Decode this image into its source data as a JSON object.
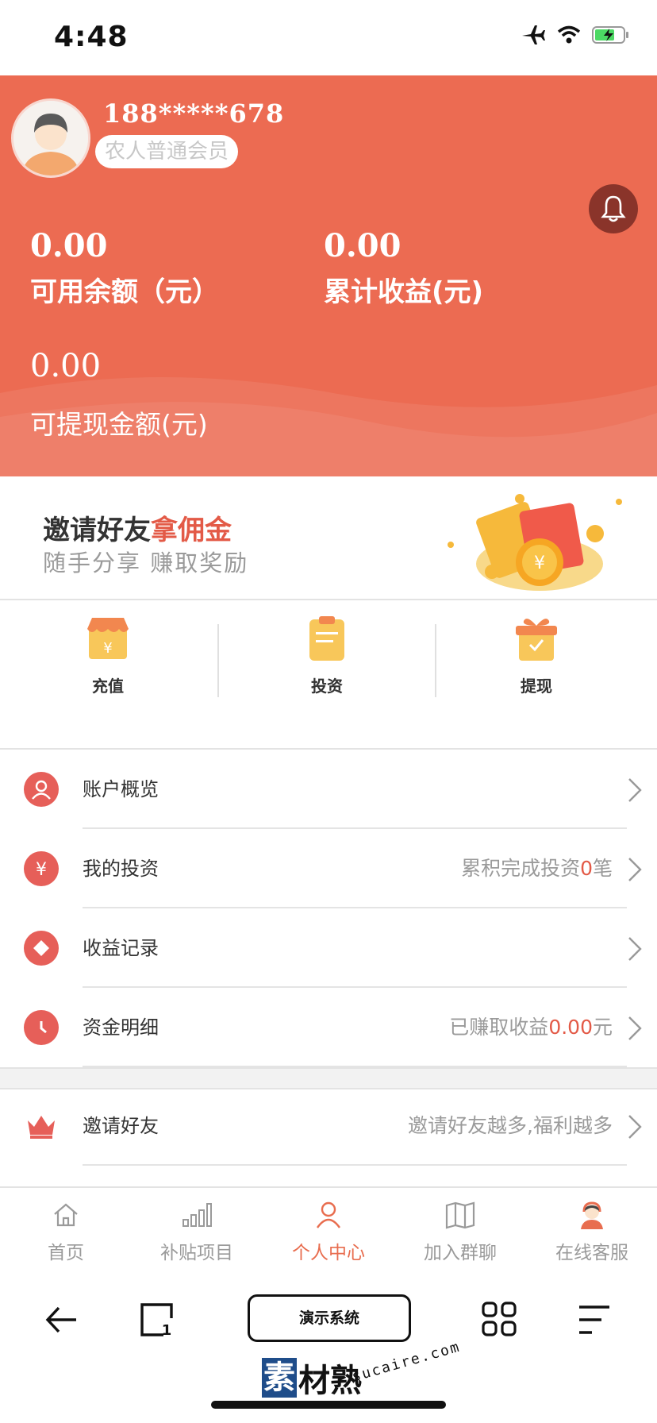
{
  "status_bar": {
    "time": "4:48"
  },
  "profile": {
    "phone": "188*****678",
    "member_level": "农人普通会员"
  },
  "balances": {
    "available": {
      "value": "0.00",
      "label": "可用余额（元）"
    },
    "total_income": {
      "value": "0.00",
      "label": "累计收益(元)"
    },
    "withdrawable": {
      "value": "0.00",
      "label": "可提现金额(元)"
    }
  },
  "invite_banner": {
    "title_main": "邀请好友",
    "title_accent": "拿佣金",
    "subtitle": "随手分享 赚取奖励"
  },
  "shortcuts": [
    {
      "label": "充值",
      "icon": "shop-icon"
    },
    {
      "label": "投资",
      "icon": "clipboard-icon"
    },
    {
      "label": "提现",
      "icon": "gift-icon"
    }
  ],
  "menu": [
    {
      "label": "账户概览",
      "icon": "user-icon",
      "extra_prefix": "",
      "extra_highlight": "",
      "extra_suffix": ""
    },
    {
      "label": "我的投资",
      "icon": "yen-icon",
      "extra_prefix": "累积完成投资",
      "extra_highlight": "0",
      "extra_suffix": "笔"
    },
    {
      "label": "收益记录",
      "icon": "diamond-icon",
      "extra_prefix": "",
      "extra_highlight": "",
      "extra_suffix": ""
    },
    {
      "label": "资金明细",
      "icon": "clock-icon",
      "extra_prefix": "已赚取收益",
      "extra_highlight": "0.00",
      "extra_suffix": "元"
    }
  ],
  "invite_row": {
    "label": "邀请好友",
    "icon": "crown-icon",
    "extra": "邀请好友越多,福利越多"
  },
  "tabs": [
    {
      "label": "首页",
      "icon": "home-icon",
      "active": false
    },
    {
      "label": "补贴项目",
      "icon": "bar-chart-icon",
      "active": false
    },
    {
      "label": "个人中心",
      "icon": "person-icon",
      "active": true
    },
    {
      "label": "加入群聊",
      "icon": "map-icon",
      "active": false
    },
    {
      "label": "在线客服",
      "icon": "support-agent-icon",
      "active": false
    }
  ],
  "toolbar": {
    "demo_label": "演示系统"
  },
  "watermark": {
    "text": "素材熟",
    "domain": "sucaire.com"
  },
  "colors": {
    "accent": "#ec6b52",
    "menu_icon": "#e65f59",
    "active_tab": "#e86d4f"
  }
}
